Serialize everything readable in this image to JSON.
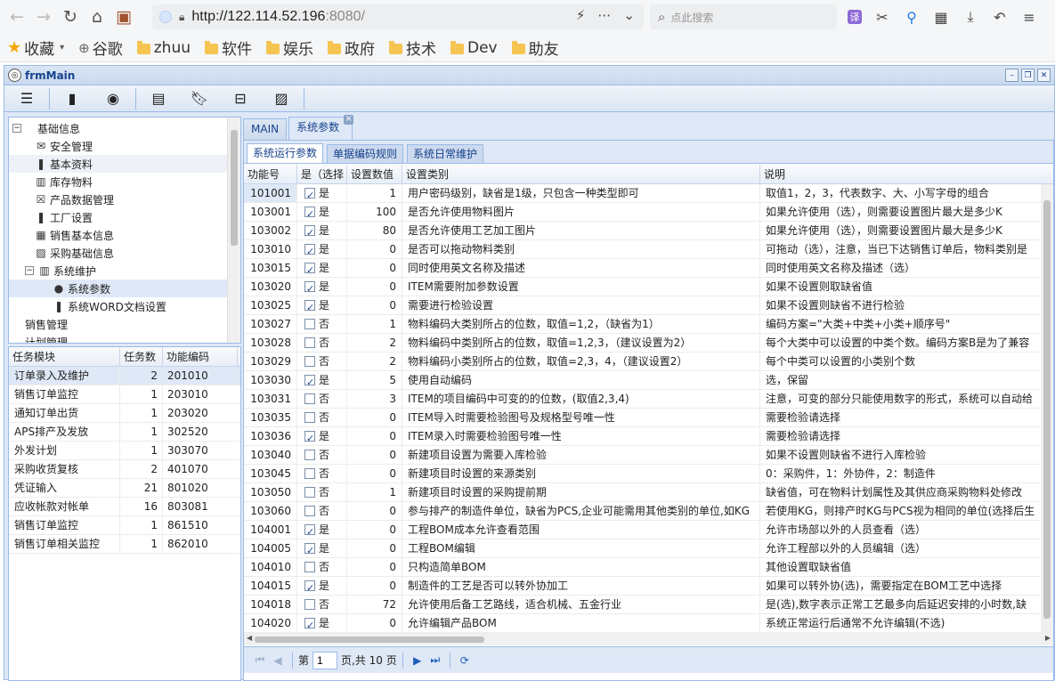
{
  "browser": {
    "url_host": "http://122.114.52.196",
    "url_port": ":8080/",
    "search_placeholder": "点此搜索",
    "translate_label": "译"
  },
  "bookmarks": [
    {
      "label": "收藏",
      "kind": "star"
    },
    {
      "label": "谷歌",
      "kind": "globe"
    },
    {
      "label": "zhuu",
      "kind": "folder"
    },
    {
      "label": "软件",
      "kind": "folder"
    },
    {
      "label": "娱乐",
      "kind": "folder"
    },
    {
      "label": "政府",
      "kind": "folder"
    },
    {
      "label": "技术",
      "kind": "folder"
    },
    {
      "label": "Dev",
      "kind": "folder"
    },
    {
      "label": "助友",
      "kind": "folder"
    }
  ],
  "app": {
    "title": "frmMain"
  },
  "tree": [
    {
      "label": "基础信息",
      "icon": "minus-toggle",
      "indent": 0
    },
    {
      "label": "安全管理",
      "icon": "mail-icon",
      "indent": 1
    },
    {
      "label": "基本资料",
      "icon": "bookmark-icon",
      "indent": 1,
      "selected": true
    },
    {
      "label": "库存物料",
      "icon": "bar-chart-icon",
      "indent": 1
    },
    {
      "label": "产品数据管理",
      "icon": "x-box-icon",
      "indent": 1
    },
    {
      "label": "工厂设置",
      "icon": "bookmark-icon",
      "indent": 1
    },
    {
      "label": "销售基本信息",
      "icon": "building-icon",
      "indent": 1
    },
    {
      "label": "采购基础信息",
      "icon": "image-icon",
      "indent": 1
    },
    {
      "label": "系统维护",
      "icon": "bar-chart-icon",
      "indent": 1,
      "expanded": true
    },
    {
      "label": "系统参数",
      "icon": "user-icon",
      "indent": 2,
      "highlight": true
    },
    {
      "label": "系统WORD文档设置",
      "icon": "bookmark-icon",
      "indent": 2
    },
    {
      "label": "销售管理",
      "icon": "",
      "indent": 0
    },
    {
      "label": "计划管理",
      "icon": "",
      "indent": 0
    }
  ],
  "task_table": {
    "headers": [
      "任务模块",
      "任务数",
      "功能编码"
    ],
    "rows": [
      [
        "订单录入及维护",
        "2",
        "201010"
      ],
      [
        "销售订单监控",
        "1",
        "203010"
      ],
      [
        "通知订单出货",
        "1",
        "203020"
      ],
      [
        "APS排产及发放",
        "1",
        "302520"
      ],
      [
        "外发计划",
        "1",
        "303070"
      ],
      [
        "采购收货复核",
        "2",
        "401070"
      ],
      [
        "凭证输入",
        "21",
        "801020"
      ],
      [
        "应收帐款对帐单",
        "16",
        "803081"
      ],
      [
        "销售订单监控",
        "1",
        "861510"
      ],
      [
        "销售订单相关监控",
        "1",
        "862010"
      ]
    ]
  },
  "tabs": [
    {
      "label": "MAIN"
    },
    {
      "label": "系统参数",
      "active": true
    }
  ],
  "subtabs": [
    {
      "label": "系统运行参数",
      "active": true
    },
    {
      "label": "单据编码规则"
    },
    {
      "label": "系统日常维护"
    }
  ],
  "grid": {
    "headers": [
      "功能号",
      "是（选择",
      "设置数值",
      "设置类别",
      "说明"
    ],
    "rows": [
      [
        "101001",
        true,
        "是",
        "1",
        "用户密码级别，缺省是1级，只包含一种类型即可",
        "取值1，2，3，代表数字、大、小写字母的组合"
      ],
      [
        "103001",
        true,
        "是",
        "100",
        "是否允许使用物料图片",
        "如果允许使用（选），则需要设置图片最大是多少K"
      ],
      [
        "103002",
        true,
        "是",
        "80",
        "是否允许使用工艺加工图片",
        "如果允许使用（选），则需要设置图片最大是多少K"
      ],
      [
        "103010",
        true,
        "是",
        "0",
        "是否可以拖动物料类别",
        "可拖动（选），注意，当已下达销售订单后，物料类别是"
      ],
      [
        "103015",
        true,
        "是",
        "0",
        "同时使用英文名称及描述",
        "同时使用英文名称及描述（选）"
      ],
      [
        "103020",
        true,
        "是",
        "0",
        "ITEM需要附加参数设置",
        "如果不设置则取缺省值"
      ],
      [
        "103025",
        true,
        "是",
        "0",
        "需要进行检验设置",
        "如果不设置则缺省不进行检验"
      ],
      [
        "103027",
        false,
        "否",
        "1",
        "物料编码大类别所占的位数，取值=1,2，（缺省为1）",
        "编码方案=\"大类+中类+小类+顺序号\""
      ],
      [
        "103028",
        false,
        "否",
        "2",
        "物料编码中类别所占的位数，取值=1,2,3，（建议设置为2）",
        "每个大类中可以设置的中类个数。编码方案B是为了兼容"
      ],
      [
        "103029",
        false,
        "否",
        "2",
        "物料编码小类别所占的位数，取值=2,3，4，（建议设置2）",
        "每个中类可以设置的小类别个数"
      ],
      [
        "103030",
        true,
        "是",
        "5",
        "使用自动编码",
        "选，保留"
      ],
      [
        "103031",
        false,
        "否",
        "3",
        "ITEM的项目编码中可变的的位数，(取值2,3,4)",
        "注意，可变的部分只能使用数字的形式，系统可以自动给"
      ],
      [
        "103035",
        false,
        "否",
        "0",
        "ITEM导入时需要检验图号及规格型号唯一性",
        "需要检验请选择"
      ],
      [
        "103036",
        true,
        "是",
        "0",
        "ITEM录入时需要检验图号唯一性",
        "需要检验请选择"
      ],
      [
        "103040",
        false,
        "否",
        "0",
        "新建项目设置为需要入库检验",
        "如果不设置则缺省不进行入库检验"
      ],
      [
        "103045",
        false,
        "否",
        "0",
        "新建项目时设置的来源类别",
        "0：采购件，1：外协件，2：制造件"
      ],
      [
        "103050",
        false,
        "否",
        "1",
        "新建项目时设置的采购提前期",
        "缺省值，可在物料计划属性及其供应商采购物料处修改"
      ],
      [
        "103060",
        false,
        "否",
        "0",
        "参与排产的制造件单位，缺省为PCS,企业可能需用其他类别的单位,如KG",
        "若使用KG，则排产时KG与PCS视为相同的单位(选择后生"
      ],
      [
        "104001",
        true,
        "是",
        "0",
        "工程BOM成本允许查看范围",
        "允许市场部以外的人员查看（选）"
      ],
      [
        "104005",
        true,
        "是",
        "0",
        "工程BOM编辑",
        "允许工程部以外的人员编辑（选）"
      ],
      [
        "104010",
        false,
        "否",
        "0",
        "只构造简单BOM",
        "其他设置取缺省值"
      ],
      [
        "104015",
        true,
        "是",
        "0",
        "制造件的工艺是否可以转外协加工",
        "如果可以转外协(选)，需要指定在BOM工艺中选择"
      ],
      [
        "104018",
        false,
        "否",
        "72",
        "允许使用后备工艺路线，适合机械、五金行业",
        "是(选),数字表示正常工艺最多向后延迟安排的小时数,缺"
      ],
      [
        "104020",
        true,
        "是",
        "0",
        "允许编辑产品BOM",
        "系统正常运行后通常不允许编辑(不选)"
      ]
    ]
  },
  "pager": {
    "page_prefix": "第",
    "page_value": "1",
    "page_suffix": "页,共 10 页"
  }
}
